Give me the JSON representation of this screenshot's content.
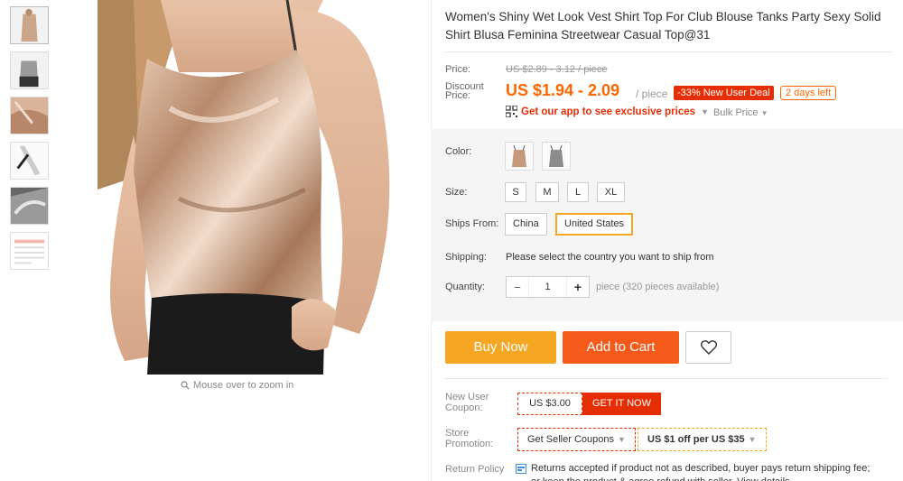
{
  "zoom_hint": "Mouse over to zoom in",
  "product": {
    "title": "Women's Shiny Wet Look Vest Shirt Top For Club Blouse Tanks Party Sexy Solid Shirt Blusa Feminina Streetwear Casual Top@31"
  },
  "price": {
    "label": "Price:",
    "original": "US $2.89 - 3.12 / piece",
    "discount_label": "Discount Price:",
    "discount": "US $1.94 - 2.09",
    "unit": "/ piece",
    "deal_badge": "-33% New User Deal",
    "days_left": "2 days left",
    "app_promo": "Get our app to see exclusive prices",
    "bulk_price": "Bulk Price"
  },
  "options": {
    "color_label": "Color:",
    "size_label": "Size:",
    "sizes": [
      "S",
      "M",
      "L",
      "XL"
    ],
    "ships_from_label": "Ships From:",
    "ships_from": [
      "China",
      "United States"
    ],
    "ships_from_selected": "United States",
    "shipping_label": "Shipping:",
    "shipping_text": "Please select the country you want to ship from",
    "quantity_label": "Quantity:",
    "quantity": "1",
    "quantity_minus": "−",
    "quantity_plus": "+",
    "quantity_note": "piece (320 pieces available)"
  },
  "actions": {
    "buy_now": "Buy Now",
    "add_to_cart": "Add to Cart"
  },
  "coupons": {
    "new_user_label": "New User Coupon:",
    "new_user_amount": "US $3.00",
    "get_it_now": "GET IT NOW",
    "store_label": "Store Promotion:",
    "seller_coupons": "Get Seller Coupons",
    "store_offer": "US $1 off per US $35",
    "return_label": "Return Policy",
    "return_text": "Returns accepted if product not as described, buyer pays return shipping fee; or keep the product & agree refund with seller. View details"
  },
  "colors": {
    "accent_orange": "#f60",
    "buy_now": "#f5a623",
    "add_to_cart": "#f55a1a",
    "red": "#e62e04"
  }
}
